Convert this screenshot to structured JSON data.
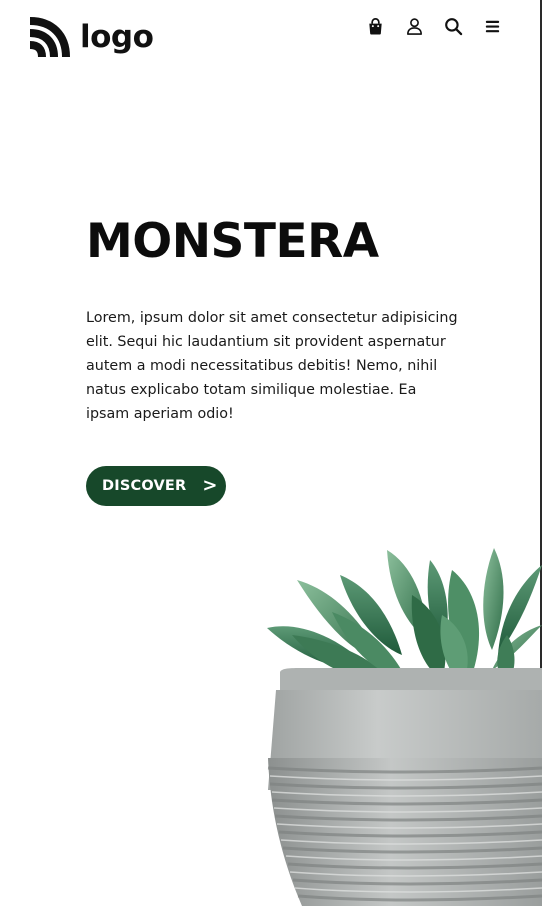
{
  "brand": {
    "logo_text": "logo",
    "logo_icon": "rss-feed-icon"
  },
  "nav": {
    "icons": [
      "shopping-bag-icon",
      "user-icon",
      "search-icon",
      "hamburger-menu-icon"
    ]
  },
  "hero": {
    "title": "MONSTERA",
    "description": "Lorem, ipsum dolor sit amet consectetur adipisicing elit. Sequi hic laudantium sit provident aspernatur autem a modi necessitatibus debitis! Nemo, nihil natus explicabo totam similique molestiae. Ea ipsam aperiam odio!",
    "cta_label": "DISCOVER",
    "cta_arrow": ">"
  },
  "colors": {
    "accent": "#17482a",
    "text": "#111111",
    "background": "#ffffff"
  },
  "image": {
    "name": "succulent-plant-in-concrete-pot"
  }
}
